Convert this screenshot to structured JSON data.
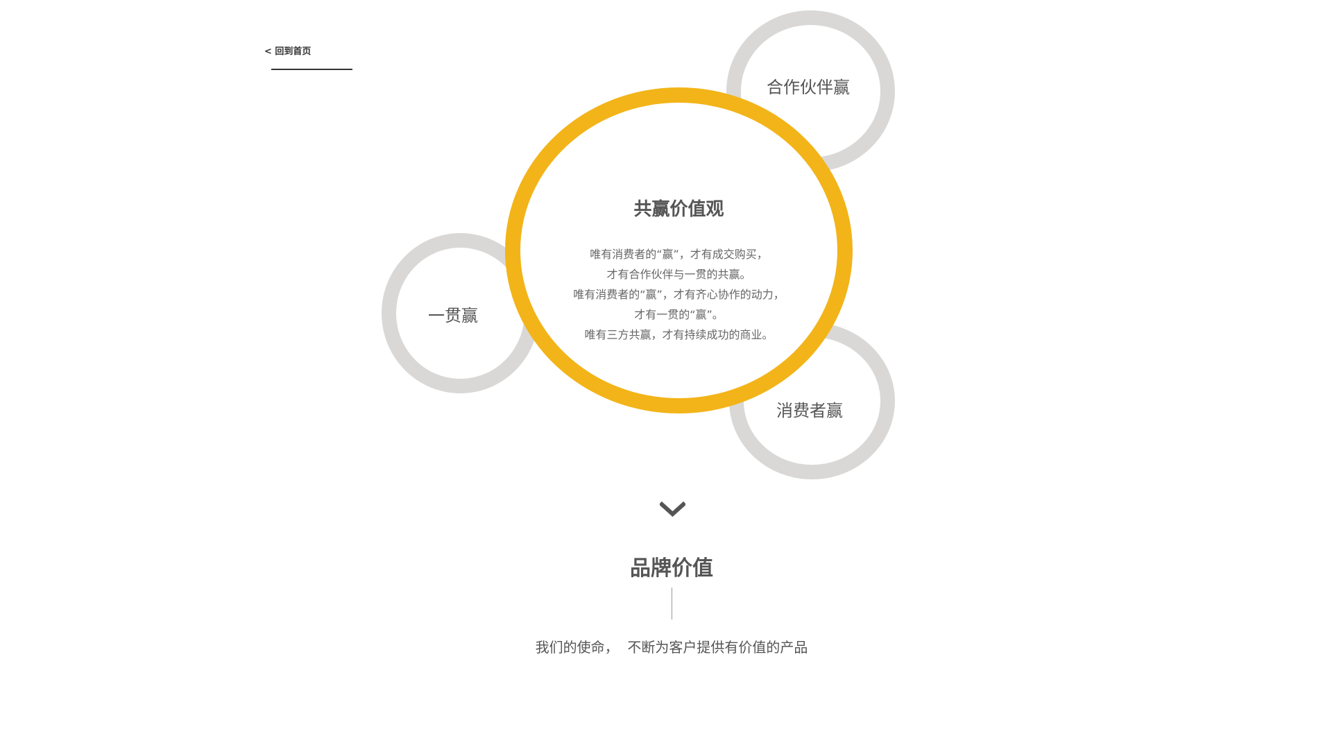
{
  "nav": {
    "back_label": "< 回到首页"
  },
  "values_diagram": {
    "center": {
      "title": "共赢价值观",
      "lines": [
        "唯有消费者的“赢”，才有成交购买，",
        "才有合作伙伴与一贯的共赢。",
        "唯有消费者的“赢”，才有齐心协作的动力，",
        "才有一贯的“赢”。",
        "唯有三方共赢，才有持续成功的商业。"
      ]
    },
    "satellites": {
      "partner": "合作伙伴赢",
      "consistent": "一贯赢",
      "consumer": "消费者赢"
    }
  },
  "brand": {
    "title": "品牌价值",
    "subtitle": "我们的使命，  不断为客户提供有价值的产品"
  },
  "icons": {
    "scroll_down": "chevron-down-icon"
  },
  "colors": {
    "accent": "#f2b418",
    "ring_grey": "#d9d8d6",
    "text": "#555555"
  }
}
